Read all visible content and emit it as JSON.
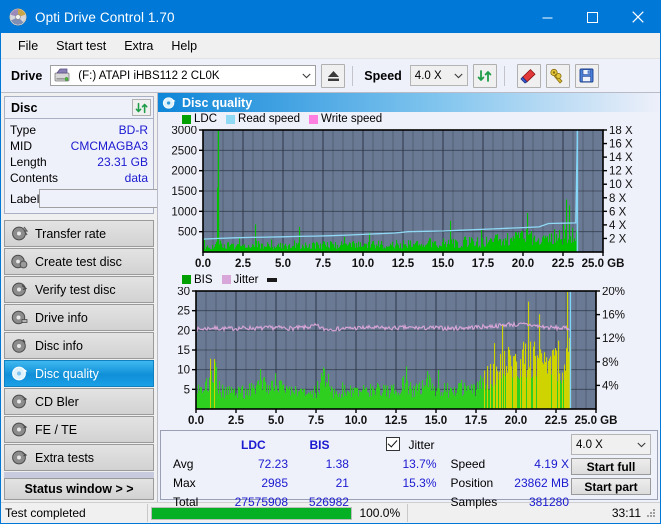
{
  "window": {
    "title": "Opti Drive Control 1.70",
    "icon": "disc-icon",
    "minimize": "minimize-icon",
    "maximize": "maximize-icon",
    "close": "close-icon"
  },
  "menu": {
    "items": [
      {
        "label": "File",
        "name": "menu-file"
      },
      {
        "label": "Start test",
        "name": "menu-start-test"
      },
      {
        "label": "Extra",
        "name": "menu-extra"
      },
      {
        "label": "Help",
        "name": "menu-help"
      }
    ]
  },
  "toolbar": {
    "drive_label": "Drive",
    "drive_value": "(F:)  ATAPI iHBS112  2 CL0K",
    "eject_icon": "eject-icon",
    "speed_label": "Speed",
    "speed_value": "4.0 X",
    "refresh_icon": "refresh-icon",
    "erase_icon": "eraser-icon",
    "tools_icon": "keys-icon",
    "save_icon": "floppy-save-icon"
  },
  "disc_panel": {
    "title": "Disc",
    "refresh_icon": "refresh-icon",
    "rows": [
      {
        "key": "Type",
        "value": "BD-R"
      },
      {
        "key": "MID",
        "value": "CMCMAGBA3"
      },
      {
        "key": "Length",
        "value": "23.31 GB"
      },
      {
        "key": "Contents",
        "value": "data"
      }
    ],
    "label_key": "Label",
    "label_value": "",
    "label_placeholder": "",
    "label_button_icon": "disc-icon"
  },
  "nav": {
    "items": [
      {
        "label": "Transfer rate",
        "name": "sidebar-item-transfer-rate",
        "icon": "disc-speed-icon",
        "active": false
      },
      {
        "label": "Create test disc",
        "name": "sidebar-item-create-test-disc",
        "icon": "disc-burn-icon",
        "active": false
      },
      {
        "label": "Verify test disc",
        "name": "sidebar-item-verify-test-disc",
        "icon": "disc-check-icon",
        "active": false
      },
      {
        "label": "Drive info",
        "name": "sidebar-item-drive-info",
        "icon": "drive-info-icon",
        "active": false
      },
      {
        "label": "Disc info",
        "name": "sidebar-item-disc-info",
        "icon": "disc-info-icon",
        "active": false
      },
      {
        "label": "Disc quality",
        "name": "sidebar-item-disc-quality",
        "icon": "disc-quality-icon",
        "active": true
      },
      {
        "label": "CD Bler",
        "name": "sidebar-item-cd-bler",
        "icon": "disc-bler-icon",
        "active": false
      },
      {
        "label": "FE / TE",
        "name": "sidebar-item-fe-te",
        "icon": "disc-fete-icon",
        "active": false
      },
      {
        "label": "Extra tests",
        "name": "sidebar-item-extra-tests",
        "icon": "disc-extra-icon",
        "active": false
      }
    ],
    "status_window": "Status window > >"
  },
  "main": {
    "header_title": "Disc quality",
    "header_icon": "disc-quality-icon"
  },
  "stats": {
    "col_ldc": "LDC",
    "col_bis": "BIS",
    "jitter_label": "Jitter",
    "jitter_checked": true,
    "row_avg": "Avg",
    "row_max": "Max",
    "row_total": "Total",
    "avg_ldc": "72.23",
    "avg_bis": "1.38",
    "avg_jitter": "13.7%",
    "max_ldc": "2985",
    "max_bis": "21",
    "max_jitter": "15.3%",
    "total_ldc": "27575908",
    "total_bis": "526982",
    "speed_label": "Speed",
    "speed_value": "4.19 X",
    "position_label": "Position",
    "position_value": "23862 MB",
    "samples_label": "Samples",
    "samples_value": "381280",
    "speed_select": "4.0 X",
    "start_full": "Start full",
    "start_part": "Start part"
  },
  "statusbar": {
    "message": "Test completed",
    "progress_percent": "100.0%",
    "progress_value": 100,
    "elapsed": "33:11"
  },
  "colors": {
    "accent": "#0078d7",
    "ldc_green": "#00c000",
    "read_speed": "#8fd9f5",
    "write_speed": "#ff7fe0",
    "bis_green": "#2fcf20",
    "jitter": "#d9a6d9",
    "plot_bg": "#6b7a94",
    "value_blue": "#1a1ad0",
    "progress_green": "#06b025"
  },
  "chart_data": [
    {
      "type": "area",
      "name": "disc-quality-ldc-chart",
      "title": "Disc quality",
      "xlabel": "GB",
      "ylabel": "LDC",
      "xlim": [
        0,
        25
      ],
      "ylim": [
        0,
        3000
      ],
      "y2lim": [
        0,
        18
      ],
      "y2label": "X",
      "xticks": [
        "0.0",
        "2.5",
        "5.0",
        "7.5",
        "10.0",
        "12.5",
        "15.0",
        "17.5",
        "20.0",
        "22.5",
        "25.0 GB"
      ],
      "yticks": [
        500,
        1000,
        1500,
        2000,
        2500,
        3000
      ],
      "y2ticks": [
        "2 X",
        "4 X",
        "6 X",
        "8 X",
        "10 X",
        "12 X",
        "14 X",
        "16 X",
        "18 X"
      ],
      "grid": true,
      "legend": [
        {
          "label": "LDC",
          "color": "#00c000"
        },
        {
          "label": "Read speed",
          "color": "#8fd9f5"
        },
        {
          "label": "Write speed",
          "color": "#ff7fe0"
        }
      ],
      "series": [
        {
          "name": "LDC",
          "color": "#00c000",
          "kind": "area",
          "x": [
            0.0,
            0.2,
            0.4,
            0.6,
            0.8,
            0.9,
            1.0,
            1.2,
            1.5,
            1.8,
            2.0,
            2.3,
            2.6,
            3.0,
            3.3,
            3.6,
            4.0,
            4.3,
            4.6,
            5.0,
            5.3,
            5.6,
            6.0,
            6.4,
            6.8,
            7.2,
            7.6,
            8.0,
            8.4,
            8.8,
            9.2,
            9.6,
            10.0,
            10.4,
            10.8,
            11.2,
            11.6,
            12.0,
            12.4,
            12.8,
            13.2,
            13.6,
            14.0,
            14.4,
            14.8,
            15.2,
            15.6,
            16.0,
            16.4,
            16.8,
            17.2,
            17.6,
            18.0,
            18.4,
            18.8,
            19.2,
            19.6,
            20.0,
            20.4,
            20.8,
            21.2,
            21.6,
            22.0,
            22.4,
            22.8,
            23.2,
            23.4
          ],
          "y": [
            120,
            150,
            180,
            200,
            230,
            2985,
            300,
            210,
            250,
            200,
            230,
            260,
            200,
            240,
            300,
            220,
            260,
            230,
            250,
            280,
            240,
            300,
            260,
            230,
            280,
            250,
            300,
            260,
            240,
            280,
            250,
            300,
            270,
            250,
            300,
            260,
            280,
            300,
            270,
            320,
            300,
            280,
            340,
            320,
            300,
            360,
            340,
            320,
            400,
            380,
            360,
            420,
            400,
            440,
            420,
            480,
            500,
            560,
            520,
            600,
            580,
            640,
            600,
            660,
            640,
            700,
            740
          ]
        },
        {
          "name": "Read speed",
          "color": "#8fd9f5",
          "kind": "line",
          "x": [
            0.0,
            1.0,
            2.0,
            3.0,
            4.0,
            5.0,
            6.0,
            7.0,
            8.0,
            9.0,
            10.0,
            11.0,
            12.0,
            12.8,
            14.0,
            15.0,
            16.0,
            17.0,
            18.0,
            19.0,
            20.0,
            21.0,
            21.6,
            22.5,
            23.3,
            23.4,
            23.4
          ],
          "y_secondary_x": [
            1.9,
            2.0,
            2.1,
            2.15,
            2.2,
            2.25,
            2.3,
            2.35,
            2.4,
            2.5,
            2.6,
            2.7,
            2.8,
            3.0,
            3.05,
            3.1,
            3.2,
            3.3,
            3.4,
            3.5,
            3.6,
            3.7,
            4.2,
            4.25,
            4.3,
            18.0,
            0.0
          ]
        },
        {
          "name": "Write speed",
          "color": "#ff7fe0",
          "kind": "line",
          "x": [],
          "y": []
        }
      ]
    },
    {
      "type": "area",
      "name": "disc-quality-bis-chart",
      "xlabel": "GB",
      "ylabel": "BIS",
      "xlim": [
        0,
        25
      ],
      "ylim": [
        0,
        30
      ],
      "y2lim": [
        0,
        20
      ],
      "y2label": "%",
      "xticks": [
        "0.0",
        "2.5",
        "5.0",
        "7.5",
        "10.0",
        "12.5",
        "15.0",
        "17.5",
        "20.0",
        "22.5",
        "25.0 GB"
      ],
      "yticks": [
        5,
        10,
        15,
        20,
        25,
        30
      ],
      "y2ticks": [
        "4%",
        "8%",
        "12%",
        "16%",
        "20%"
      ],
      "grid": true,
      "legend": [
        {
          "label": "BIS",
          "color": "#2fcf20"
        },
        {
          "label": "Jitter",
          "color": "#d9a6d9"
        }
      ],
      "series": [
        {
          "name": "BIS",
          "color": "#2fcf20",
          "kind": "area",
          "x": [
            0.0,
            0.5,
            1.0,
            1.5,
            2.0,
            2.5,
            3.0,
            3.5,
            4.0,
            4.5,
            5.0,
            5.5,
            6.0,
            6.5,
            7.0,
            7.5,
            8.0,
            8.5,
            9.0,
            9.5,
            10.0,
            10.5,
            11.0,
            11.5,
            12.0,
            12.5,
            13.0,
            13.5,
            14.0,
            14.5,
            15.0,
            15.5,
            16.0,
            16.5,
            17.0,
            17.5,
            18.0,
            18.5,
            19.0,
            19.5,
            20.0,
            20.5,
            21.0,
            21.5,
            22.0,
            22.5,
            23.0,
            23.3
          ],
          "y": [
            6.5,
            5.5,
            14.2,
            6.0,
            5.5,
            6.0,
            5.5,
            6.5,
            10.0,
            5.5,
            9.5,
            6.0,
            5.5,
            6.0,
            5.5,
            6.0,
            12.2,
            5.5,
            6.0,
            6.5,
            5.5,
            6.0,
            6.5,
            6.0,
            5.5,
            6.5,
            10.0,
            6.0,
            6.5,
            10.0,
            6.0,
            6.5,
            6.0,
            7.0,
            6.5,
            7.0,
            10.5,
            11.0,
            13.5,
            16.0,
            14.0,
            17.0,
            17.0,
            16.0,
            12.0,
            16.0,
            12.0,
            21.0
          ]
        },
        {
          "name": "Jitter",
          "color": "#d9a6d9",
          "kind": "line",
          "x": [
            0.0,
            1.0,
            2.0,
            3.0,
            4.0,
            5.0,
            6.0,
            7.0,
            7.5,
            8.0,
            9.0,
            10.0,
            11.0,
            12.0,
            13.0,
            14.0,
            15.0,
            16.0,
            17.0,
            18.0,
            19.0,
            19.6,
            20.0,
            20.6,
            21.0,
            22.0,
            22.5,
            23.3
          ],
          "y": [
            20.2,
            20.6,
            20.4,
            20.6,
            20.5,
            20.7,
            20.5,
            20.8,
            21.2,
            20.3,
            20.4,
            20.6,
            20.7,
            20.5,
            20.7,
            20.6,
            20.6,
            20.5,
            20.7,
            20.9,
            21.2,
            21.6,
            21.4,
            21.5,
            21.3,
            20.7,
            20.6,
            20.5
          ]
        }
      ]
    }
  ]
}
